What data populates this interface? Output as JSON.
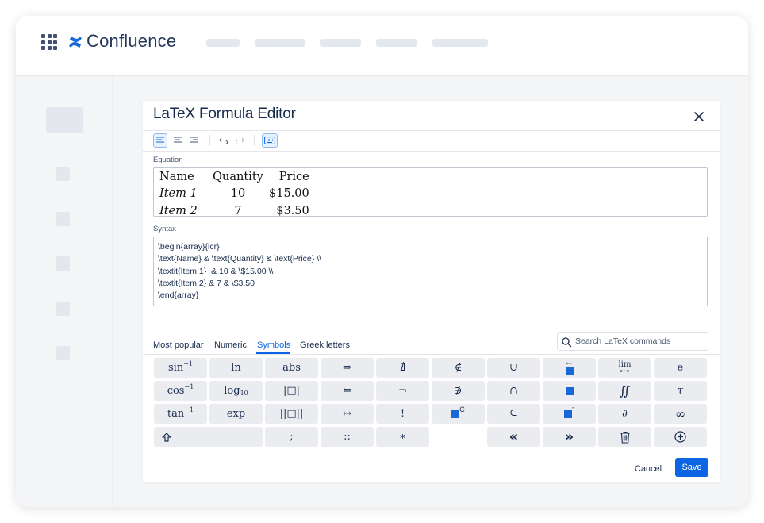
{
  "app": {
    "name": "Confluence"
  },
  "dialog": {
    "title": "LaTeX Formula Editor",
    "equation_label": "Equation",
    "syntax_label": "Syntax",
    "equation": {
      "header": [
        "Name",
        "Quantity",
        "Price"
      ],
      "rows": [
        [
          "Item 1",
          "10",
          "$15.00"
        ],
        [
          "Item 2",
          "7",
          "$3.50"
        ]
      ]
    },
    "syntax_lines": [
      "\\begin{array}{lcr}",
      "\\text{Name} & \\text{Quantity} & \\text{Price} \\\\",
      "\\textit{Item 1}  & 10 & \\$15.00 \\\\",
      "\\textit{Item 2} & 7 & \\$3.50",
      "\\end{array}"
    ],
    "tabs": [
      "Most popular",
      "Numeric",
      "Symbols",
      "Greek letters"
    ],
    "active_tab": "Symbols",
    "search_placeholder": "Search LaTeX commands",
    "keys": {
      "sin": "sin",
      "sin_sup": "−1",
      "cos": "cos",
      "cos_sup": "−1",
      "tan": "tan",
      "tan_sup": "−1",
      "ln": "ln",
      "log": "log",
      "log_sub": "10",
      "exp": "exp",
      "abs": "abs",
      "abs_box": "|□|",
      "norm_box": "||□||",
      "implies": "⇒",
      "impliedby": "⇐",
      "iff": "↔",
      "nexists": "∄",
      "neg": "¬",
      "factorial": "!",
      "notin": "∉",
      "notni": "∌",
      "complement_sup": "C",
      "cup": "∪",
      "cap": "∩",
      "subseteq": "⊆",
      "overleftarrow": "←",
      "second_prime": "″",
      "lim": "lim",
      "lim_sub": "z→∞",
      "iint": "∬",
      "partial": "∂",
      "e": "e",
      "tau": "τ",
      "infinity": "∞",
      "semicolon": ";",
      "dcolon": "::",
      "asterisk": "∗",
      "double_left": "«",
      "double_right": "»"
    },
    "cancel_label": "Cancel",
    "save_label": "Save"
  },
  "colors": {
    "accent": "#0c66e4",
    "brand": "#1868db",
    "text": "#172b4d"
  }
}
